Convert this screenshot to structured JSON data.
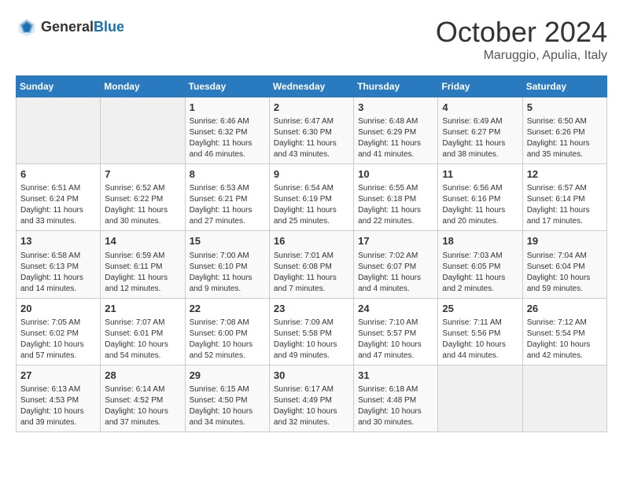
{
  "header": {
    "logo_general": "General",
    "logo_blue": "Blue",
    "month_title": "October 2024",
    "subtitle": "Maruggio, Apulia, Italy"
  },
  "days_of_week": [
    "Sunday",
    "Monday",
    "Tuesday",
    "Wednesday",
    "Thursday",
    "Friday",
    "Saturday"
  ],
  "weeks": [
    [
      {
        "day": "",
        "info": ""
      },
      {
        "day": "",
        "info": ""
      },
      {
        "day": "1",
        "info": "Sunrise: 6:46 AM\nSunset: 6:32 PM\nDaylight: 11 hours and 46 minutes."
      },
      {
        "day": "2",
        "info": "Sunrise: 6:47 AM\nSunset: 6:30 PM\nDaylight: 11 hours and 43 minutes."
      },
      {
        "day": "3",
        "info": "Sunrise: 6:48 AM\nSunset: 6:29 PM\nDaylight: 11 hours and 41 minutes."
      },
      {
        "day": "4",
        "info": "Sunrise: 6:49 AM\nSunset: 6:27 PM\nDaylight: 11 hours and 38 minutes."
      },
      {
        "day": "5",
        "info": "Sunrise: 6:50 AM\nSunset: 6:26 PM\nDaylight: 11 hours and 35 minutes."
      }
    ],
    [
      {
        "day": "6",
        "info": "Sunrise: 6:51 AM\nSunset: 6:24 PM\nDaylight: 11 hours and 33 minutes."
      },
      {
        "day": "7",
        "info": "Sunrise: 6:52 AM\nSunset: 6:22 PM\nDaylight: 11 hours and 30 minutes."
      },
      {
        "day": "8",
        "info": "Sunrise: 6:53 AM\nSunset: 6:21 PM\nDaylight: 11 hours and 27 minutes."
      },
      {
        "day": "9",
        "info": "Sunrise: 6:54 AM\nSunset: 6:19 PM\nDaylight: 11 hours and 25 minutes."
      },
      {
        "day": "10",
        "info": "Sunrise: 6:55 AM\nSunset: 6:18 PM\nDaylight: 11 hours and 22 minutes."
      },
      {
        "day": "11",
        "info": "Sunrise: 6:56 AM\nSunset: 6:16 PM\nDaylight: 11 hours and 20 minutes."
      },
      {
        "day": "12",
        "info": "Sunrise: 6:57 AM\nSunset: 6:14 PM\nDaylight: 11 hours and 17 minutes."
      }
    ],
    [
      {
        "day": "13",
        "info": "Sunrise: 6:58 AM\nSunset: 6:13 PM\nDaylight: 11 hours and 14 minutes."
      },
      {
        "day": "14",
        "info": "Sunrise: 6:59 AM\nSunset: 6:11 PM\nDaylight: 11 hours and 12 minutes."
      },
      {
        "day": "15",
        "info": "Sunrise: 7:00 AM\nSunset: 6:10 PM\nDaylight: 11 hours and 9 minutes."
      },
      {
        "day": "16",
        "info": "Sunrise: 7:01 AM\nSunset: 6:08 PM\nDaylight: 11 hours and 7 minutes."
      },
      {
        "day": "17",
        "info": "Sunrise: 7:02 AM\nSunset: 6:07 PM\nDaylight: 11 hours and 4 minutes."
      },
      {
        "day": "18",
        "info": "Sunrise: 7:03 AM\nSunset: 6:05 PM\nDaylight: 11 hours and 2 minutes."
      },
      {
        "day": "19",
        "info": "Sunrise: 7:04 AM\nSunset: 6:04 PM\nDaylight: 10 hours and 59 minutes."
      }
    ],
    [
      {
        "day": "20",
        "info": "Sunrise: 7:05 AM\nSunset: 6:02 PM\nDaylight: 10 hours and 57 minutes."
      },
      {
        "day": "21",
        "info": "Sunrise: 7:07 AM\nSunset: 6:01 PM\nDaylight: 10 hours and 54 minutes."
      },
      {
        "day": "22",
        "info": "Sunrise: 7:08 AM\nSunset: 6:00 PM\nDaylight: 10 hours and 52 minutes."
      },
      {
        "day": "23",
        "info": "Sunrise: 7:09 AM\nSunset: 5:58 PM\nDaylight: 10 hours and 49 minutes."
      },
      {
        "day": "24",
        "info": "Sunrise: 7:10 AM\nSunset: 5:57 PM\nDaylight: 10 hours and 47 minutes."
      },
      {
        "day": "25",
        "info": "Sunrise: 7:11 AM\nSunset: 5:56 PM\nDaylight: 10 hours and 44 minutes."
      },
      {
        "day": "26",
        "info": "Sunrise: 7:12 AM\nSunset: 5:54 PM\nDaylight: 10 hours and 42 minutes."
      }
    ],
    [
      {
        "day": "27",
        "info": "Sunrise: 6:13 AM\nSunset: 4:53 PM\nDaylight: 10 hours and 39 minutes."
      },
      {
        "day": "28",
        "info": "Sunrise: 6:14 AM\nSunset: 4:52 PM\nDaylight: 10 hours and 37 minutes."
      },
      {
        "day": "29",
        "info": "Sunrise: 6:15 AM\nSunset: 4:50 PM\nDaylight: 10 hours and 34 minutes."
      },
      {
        "day": "30",
        "info": "Sunrise: 6:17 AM\nSunset: 4:49 PM\nDaylight: 10 hours and 32 minutes."
      },
      {
        "day": "31",
        "info": "Sunrise: 6:18 AM\nSunset: 4:48 PM\nDaylight: 10 hours and 30 minutes."
      },
      {
        "day": "",
        "info": ""
      },
      {
        "day": "",
        "info": ""
      }
    ]
  ]
}
